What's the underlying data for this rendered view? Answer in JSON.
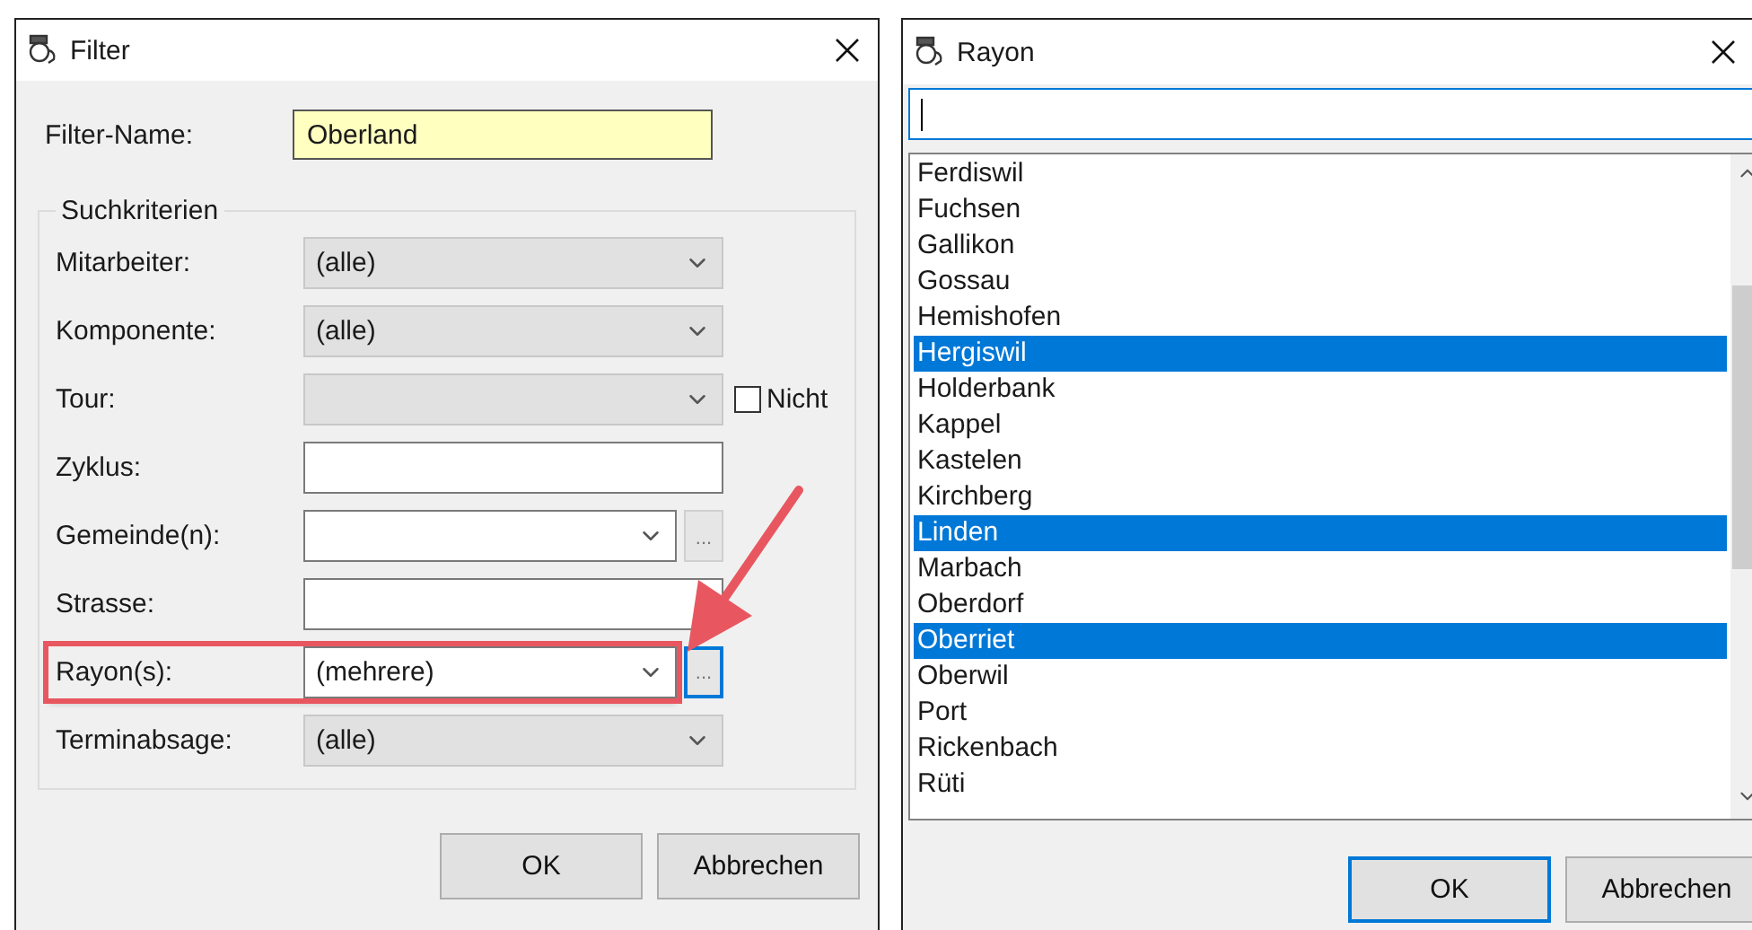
{
  "filter_window": {
    "title": "Filter",
    "filter_name": {
      "label": "Filter-Name:",
      "value": "Oberland"
    },
    "criteria": {
      "title": "Suchkriterien",
      "rows": [
        {
          "kind": "combo",
          "label": "Mitarbeiter:",
          "value": "(alle)"
        },
        {
          "kind": "combo",
          "label": "Komponente:",
          "value": "(alle)"
        },
        {
          "kind": "combo",
          "label": "Tour:",
          "value": "",
          "checkbox": {
            "label": "Nicht",
            "checked": false
          }
        },
        {
          "kind": "text",
          "label": "Zyklus:",
          "value": ""
        },
        {
          "kind": "edit_combo",
          "label": "Gemeinde(n):",
          "value": "",
          "browse": {
            "label": "...",
            "focused": false
          }
        },
        {
          "kind": "text",
          "label": "Strasse:",
          "value": ""
        },
        {
          "kind": "edit_combo",
          "label": "Rayon(s):",
          "value": "(mehrere)",
          "highlighted": true,
          "browse": {
            "label": "...",
            "focused": true
          }
        },
        {
          "kind": "combo",
          "label": "Terminabsage:",
          "value": "(alle)"
        }
      ]
    },
    "buttons": [
      {
        "label": "OK",
        "default": false
      },
      {
        "label": "Abbrechen",
        "default": false
      }
    ]
  },
  "rayon_window": {
    "title": "Rayon",
    "search": {
      "focused": true
    },
    "items": [
      {
        "label": "Ferdiswil",
        "selected": false
      },
      {
        "label": "Fuchsen",
        "selected": false
      },
      {
        "label": "Gallikon",
        "selected": false
      },
      {
        "label": "Gossau",
        "selected": false
      },
      {
        "label": "Hemishofen",
        "selected": false
      },
      {
        "label": "Hergiswil",
        "selected": true
      },
      {
        "label": "Holderbank",
        "selected": false
      },
      {
        "label": "Kappel",
        "selected": false
      },
      {
        "label": "Kastelen",
        "selected": false
      },
      {
        "label": "Kirchberg",
        "selected": false
      },
      {
        "label": "Linden",
        "selected": true
      },
      {
        "label": "Marbach",
        "selected": false
      },
      {
        "label": "Oberdorf",
        "selected": false
      },
      {
        "label": "Oberriet",
        "selected": true
      },
      {
        "label": "Oberwil",
        "selected": false
      },
      {
        "label": "Port",
        "selected": false
      },
      {
        "label": "Rickenbach",
        "selected": false
      },
      {
        "label": "Rüti",
        "selected": false
      }
    ],
    "buttons": [
      {
        "label": "OK",
        "default": true
      },
      {
        "label": "Abbrechen",
        "default": false
      }
    ]
  }
}
